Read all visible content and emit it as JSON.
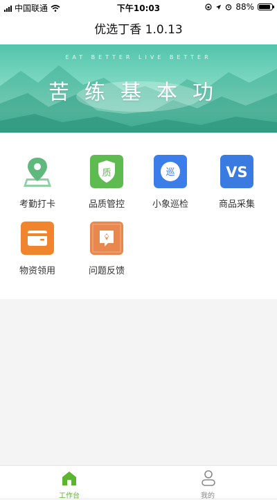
{
  "status_bar": {
    "carrier": "中国联通",
    "time": "下午10:03",
    "battery": "88%",
    "battery_level": 0.88
  },
  "nav": {
    "title": "优选丁香 1.0.13"
  },
  "banner": {
    "subtitle": "EAT BETTER  LIVE BETTER",
    "title": "苦练基本功"
  },
  "grid": [
    {
      "label": "考勤打卡",
      "icon": "map-pin-icon",
      "color": "#6cc28a"
    },
    {
      "label": "品质管控",
      "icon": "quality-shield-icon",
      "color": "#5dbb4f",
      "glyph": "质"
    },
    {
      "label": "小象巡检",
      "icon": "patrol-icon",
      "color": "#3b7de9",
      "glyph": "巡"
    },
    {
      "label": "商品采集",
      "icon": "vs-icon",
      "color": "#3a7be2",
      "glyph": "VS"
    },
    {
      "label": "物资领用",
      "icon": "wallet-icon",
      "color": "#f0852d"
    },
    {
      "label": "问题反馈",
      "icon": "feedback-icon",
      "color": "#e8874e"
    }
  ],
  "tabs": [
    {
      "label": "工作台",
      "icon": "home-icon",
      "active": true,
      "color": "#5cb531"
    },
    {
      "label": "我的",
      "icon": "profile-icon",
      "active": false,
      "color": "#888888"
    }
  ]
}
